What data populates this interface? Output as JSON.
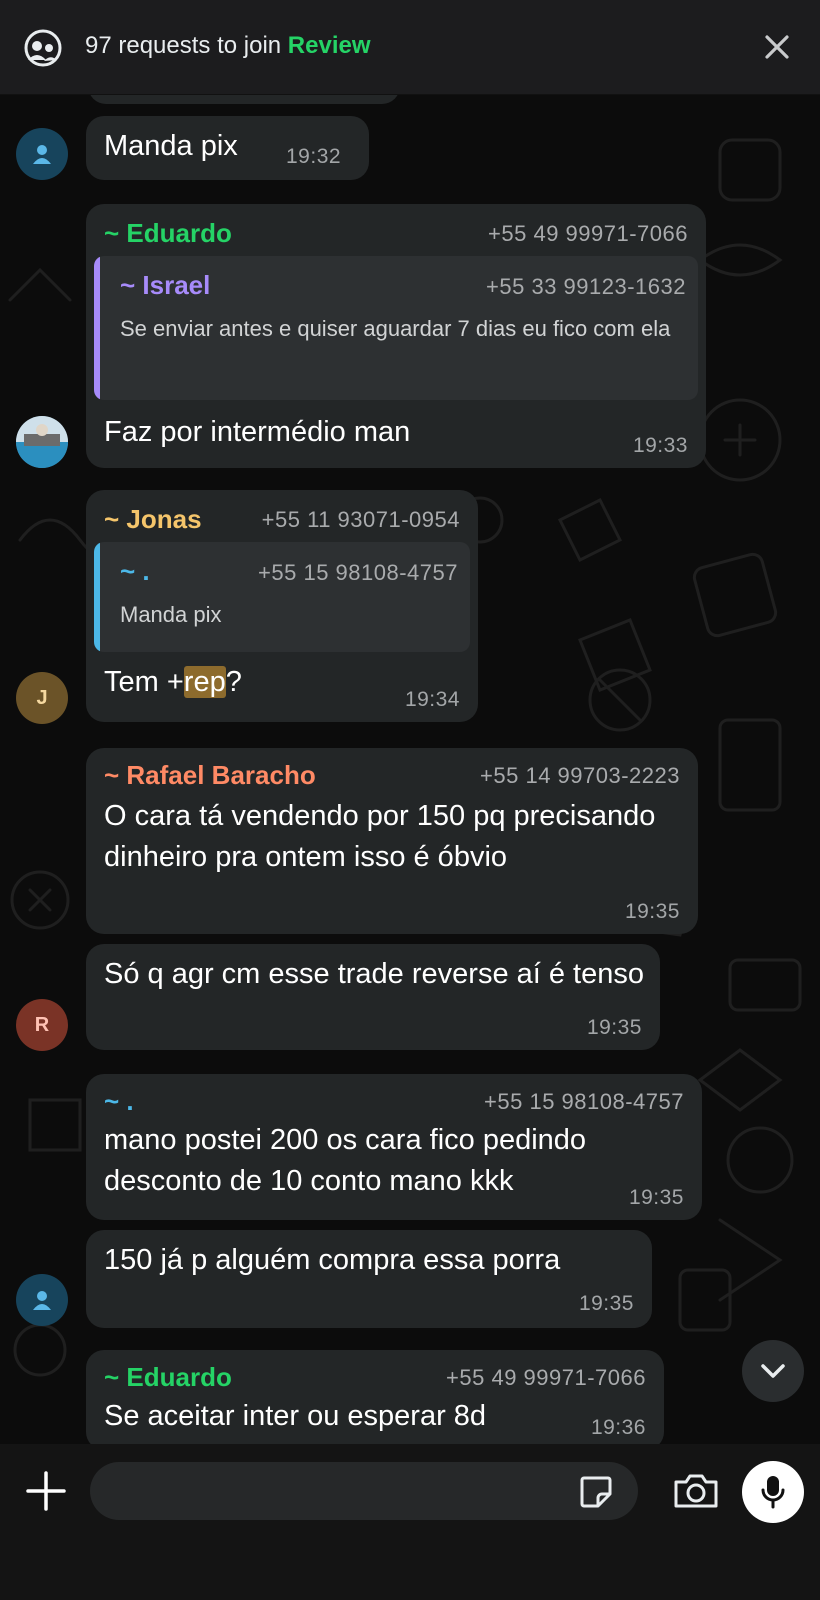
{
  "banner": {
    "requests_text": "97 requests to join",
    "review_label": "Review",
    "icons": {
      "group": "group-requests-icon",
      "close": "close-icon"
    }
  },
  "colors": {
    "accent": "#25d366",
    "eduardo": "#25d366",
    "israel": "#a78bfa",
    "jonas": "#f5c56b",
    "dot_user": "#4cb8e8",
    "rafael": "#ff8a65",
    "bubble": "#232627"
  },
  "messages": [
    {
      "text": "Manda pix",
      "time": "19:32"
    },
    {
      "sender": "~ Eduardo",
      "phone": "+55 49 99971-7066",
      "quote": {
        "sender": "~ Israel",
        "phone": "+55 33 99123-1632",
        "text": "Se enviar antes e quiser aguardar 7 dias eu fico com ela"
      },
      "text": "Faz por intermédio man",
      "time": "19:33"
    },
    {
      "sender": "~ Jonas",
      "phone": "+55 11 93071-0954",
      "quote": {
        "sender": "~ .",
        "phone": "+55 15 98108-4757",
        "text": "Manda pix"
      },
      "text_before": "Tem +",
      "text_highlight": "rep",
      "text_after": "?",
      "time": "19:34",
      "avatar_letter": "J"
    },
    {
      "sender": "~ Rafael Baracho",
      "phone": "+55 14 99703-2223",
      "text": "O cara tá vendendo por 150 pq precisando dinheiro pra ontem  isso é óbvio",
      "time": "19:35"
    },
    {
      "text": "Só q agr cm esse trade reverse aí é tenso",
      "time": "19:35",
      "avatar_letter": "R"
    },
    {
      "sender": "~ .",
      "phone": "+55 15 98108-4757",
      "text": "mano postei 200 os cara fico pedindo desconto de 10 conto mano kkk",
      "time": "19:35"
    },
    {
      "text": "150 já p alguém compra essa porra",
      "time": "19:35"
    },
    {
      "sender": "~ Eduardo",
      "phone": "+55 49 99971-7066",
      "text": "Se aceitar inter ou esperar 8d",
      "time": "19:36"
    }
  ],
  "input": {
    "placeholder": ""
  },
  "icons": {
    "plus": "plus-icon",
    "sticker": "sticker-icon",
    "camera": "camera-icon",
    "mic": "microphone-icon",
    "scroll": "chevron-down-icon",
    "default_avatar": "person-icon"
  }
}
